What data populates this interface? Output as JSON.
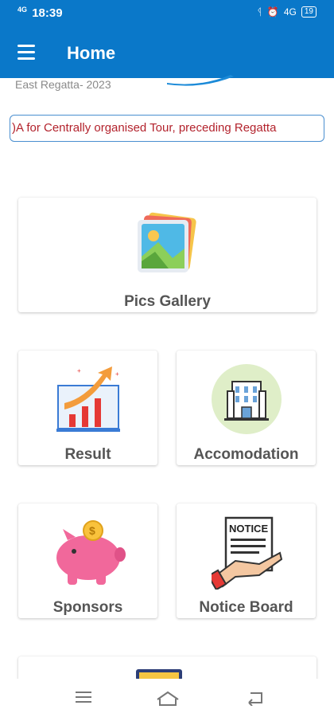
{
  "status": {
    "time": "18:39",
    "network_left": "4G",
    "network_left2": "4G",
    "battery": "19",
    "network_right": "4G"
  },
  "app_bar": {
    "title": "Home"
  },
  "banner": {
    "subtitle": "East Regatta- 2023"
  },
  "ticker": {
    "text": ")A for Centrally organised Tour, preceding Regatta"
  },
  "cards": {
    "gallery": {
      "label": "Pics Gallery"
    },
    "result": {
      "label": "Result"
    },
    "accommodation": {
      "label": "Accomodation"
    },
    "sponsors": {
      "label": "Sponsors"
    },
    "notice": {
      "label": "Notice Board",
      "icon_text": "NOTICE"
    }
  },
  "icons": {
    "menu": "hamburger-icon",
    "bluetooth": "bluetooth-icon",
    "alarm": "alarm-icon",
    "nav_menu": "menu-lines-icon",
    "nav_home": "home-icon",
    "nav_back": "back-icon"
  },
  "colors": {
    "primary": "#0a78c9",
    "ticker_text": "#b3232d",
    "ticker_border": "#4a8fd0",
    "card_label": "#555555"
  }
}
